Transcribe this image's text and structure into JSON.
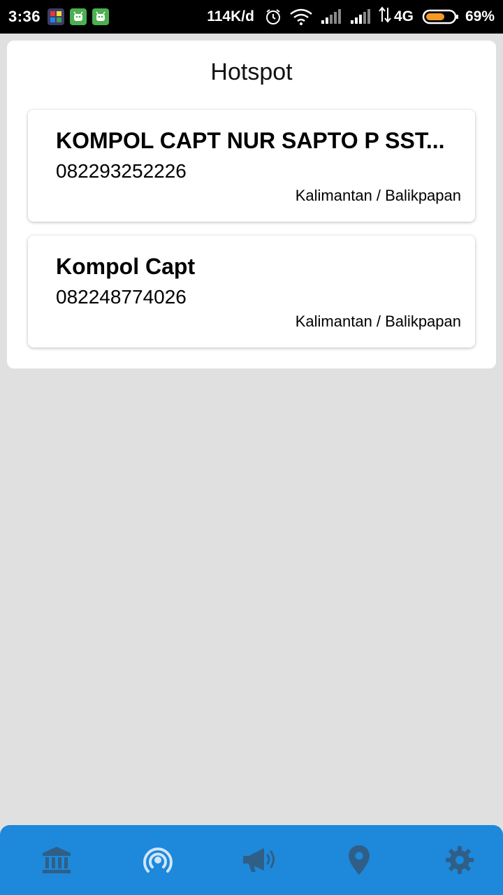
{
  "status_bar": {
    "time": "3:36",
    "network_speed": "114K/d",
    "network_type": "4G",
    "battery_percent": "69%",
    "battery_level": 0.69,
    "icons": [
      "puzzle-app-icon",
      "android-app-icon",
      "android-app-icon",
      "alarm-icon",
      "wifi-icon",
      "signal-icon",
      "signal-icon",
      "data-transfer-icon",
      "battery-icon"
    ]
  },
  "page": {
    "title": "Hotspot"
  },
  "entries": [
    {
      "name": "KOMPOL CAPT NUR SAPTO P SST...",
      "phone": "082293252226",
      "location": "Kalimantan / Balikpapan"
    },
    {
      "name": "Kompol Capt",
      "phone": "082248774026",
      "location": "Kalimantan / Balikpapan"
    }
  ],
  "bottom_nav": {
    "items": [
      {
        "icon": "bank-icon",
        "active": false
      },
      {
        "icon": "hotspot-icon",
        "active": true
      },
      {
        "icon": "megaphone-icon",
        "active": false
      },
      {
        "icon": "location-pin-icon",
        "active": false
      },
      {
        "icon": "gear-icon",
        "active": false
      }
    ],
    "colors": {
      "background": "#1e88db",
      "inactive": "#2f5f86",
      "active": "#cfe6fa"
    }
  }
}
